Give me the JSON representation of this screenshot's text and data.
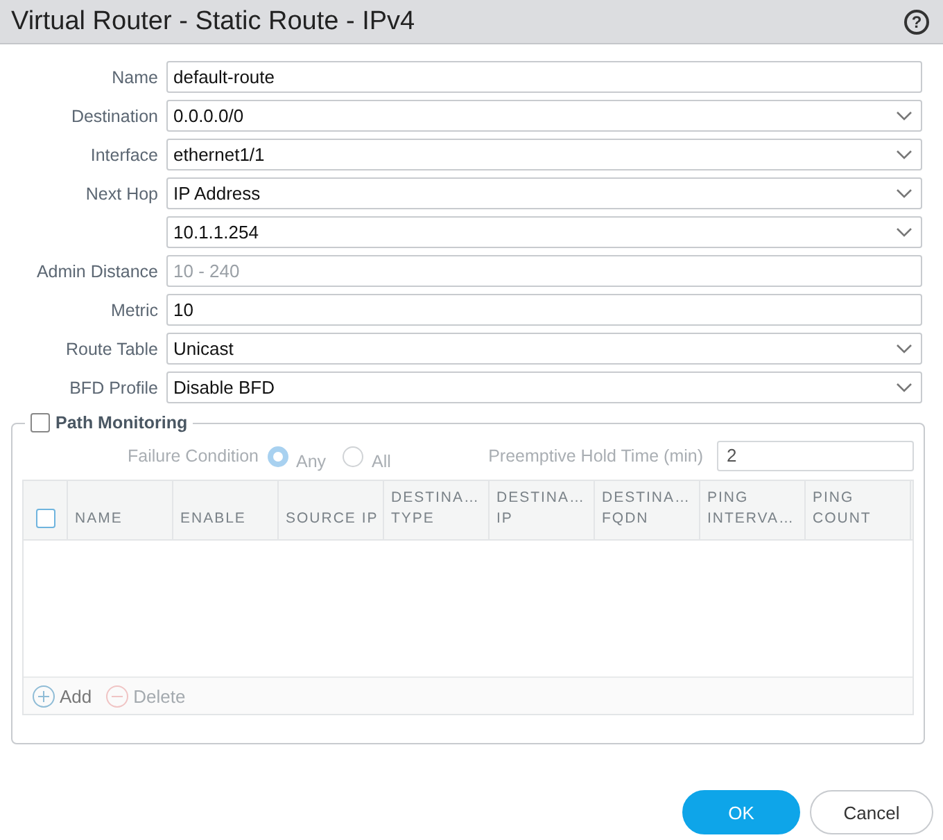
{
  "window": {
    "title": "Virtual Router - Static Route - IPv4",
    "help_symbol": "?"
  },
  "fields": [
    {
      "label": "Name",
      "kind": "text",
      "value": "default-route"
    },
    {
      "label": "Destination",
      "kind": "select",
      "value": "0.0.0.0/0"
    },
    {
      "label": "Interface",
      "kind": "select",
      "value": "ethernet1/1"
    },
    {
      "label": "Next Hop",
      "kind": "select",
      "value": "IP Address"
    },
    {
      "kind": "select",
      "value": "10.1.1.254"
    },
    {
      "label": "Admin Distance",
      "kind": "text",
      "placeholder": "10 - 240"
    },
    {
      "label": "Metric",
      "kind": "text",
      "value": "10"
    },
    {
      "label": "Route Table",
      "kind": "select",
      "value": "Unicast"
    },
    {
      "label": "BFD Profile",
      "kind": "select",
      "value": "Disable BFD"
    }
  ],
  "path_monitoring": {
    "label": "Path Monitoring",
    "checked": false,
    "failure_condition": {
      "label": "Failure Condition",
      "options": [
        {
          "label": "Any",
          "selected": true
        },
        {
          "label": "All",
          "selected": false
        }
      ]
    },
    "hold_time": {
      "label": "Preemptive Hold Time (min)",
      "value": "2"
    },
    "table": {
      "select_all_checked": false,
      "columns": [
        {
          "lines": [
            "NAME"
          ]
        },
        {
          "lines": [
            "ENABLE"
          ]
        },
        {
          "lines": [
            "SOURCE IP"
          ]
        },
        {
          "lines": [
            "DESTINA…",
            "TYPE"
          ]
        },
        {
          "lines": [
            "DESTINA…",
            "IP"
          ]
        },
        {
          "lines": [
            "DESTINA…",
            "FQDN"
          ]
        },
        {
          "lines": [
            "PING",
            "INTERVA…"
          ]
        },
        {
          "lines": [
            "PING",
            "COUNT"
          ]
        }
      ],
      "actions": [
        {
          "label": "Add",
          "kind": "add",
          "disabled": false
        },
        {
          "label": "Delete",
          "kind": "delete",
          "disabled": true
        }
      ]
    }
  },
  "buttons": [
    {
      "label": "OK",
      "kind": "primary"
    },
    {
      "label": "Cancel",
      "kind": "secondary"
    }
  ]
}
